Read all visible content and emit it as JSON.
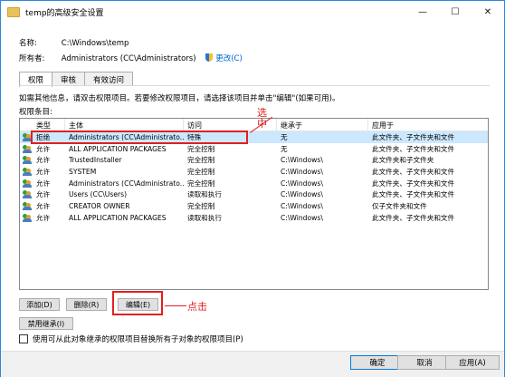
{
  "window": {
    "title": "temp的高级安全设置",
    "controls": {
      "minimize": "—",
      "maximize": "☐",
      "close": "✕"
    }
  },
  "info": {
    "name_label": "名称:",
    "name_value": "C:\\Windows\\temp",
    "owner_label": "所有者:",
    "owner_value": "Administrators (CC\\Administrators)",
    "change_link": "更改(C)"
  },
  "tabs": [
    "权限",
    "审核",
    "有效访问"
  ],
  "hint": "如需其他信息，请双击权限项目。若要修改权限项目，请选择该项目并单击\"编辑\"(如果可用)。",
  "permission_entries_label": "权限条目:",
  "columns": [
    "类型",
    "主体",
    "访问",
    "继承于",
    "应用于"
  ],
  "rows": [
    {
      "type": "拒绝",
      "principal": "Administrators (CC\\Administrato...",
      "access": "特殊",
      "inherited": "无",
      "applies": "此文件夹、子文件夹和文件"
    },
    {
      "type": "允许",
      "principal": "ALL APPLICATION PACKAGES",
      "access": "完全控制",
      "inherited": "无",
      "applies": "此文件夹、子文件夹和文件"
    },
    {
      "type": "允许",
      "principal": "TrustedInstaller",
      "access": "完全控制",
      "inherited": "C:\\Windows\\",
      "applies": "此文件夹和子文件夹"
    },
    {
      "type": "允许",
      "principal": "SYSTEM",
      "access": "完全控制",
      "inherited": "C:\\Windows\\",
      "applies": "此文件夹、子文件夹和文件"
    },
    {
      "type": "允许",
      "principal": "Administrators (CC\\Administrato...",
      "access": "完全控制",
      "inherited": "C:\\Windows\\",
      "applies": "此文件夹、子文件夹和文件"
    },
    {
      "type": "允许",
      "principal": "Users (CC\\Users)",
      "access": "读取和执行",
      "inherited": "C:\\Windows\\",
      "applies": "此文件夹、子文件夹和文件"
    },
    {
      "type": "允许",
      "principal": "CREATOR OWNER",
      "access": "完全控制",
      "inherited": "C:\\Windows\\",
      "applies": "仅子文件夹和文件"
    },
    {
      "type": "允许",
      "principal": "ALL APPLICATION PACKAGES",
      "access": "读取和执行",
      "inherited": "C:\\Windows\\",
      "applies": "此文件夹、子文件夹和文件"
    }
  ],
  "annotations": {
    "select": "选中",
    "click": "点击"
  },
  "buttons": {
    "add": "添加(D)",
    "remove": "删除(R)",
    "edit": "编辑(E)",
    "disable_inheritance": "禁用继承(I)"
  },
  "checkbox_label": "使用可从此对象继承的权限项目替换所有子对象的权限项目(P)",
  "footer": {
    "ok": "确定",
    "cancel": "取消",
    "apply": "应用(A)"
  },
  "colors": {
    "accent": "#0078d7",
    "selection": "#cce8ff",
    "annotation": "#e02020"
  }
}
